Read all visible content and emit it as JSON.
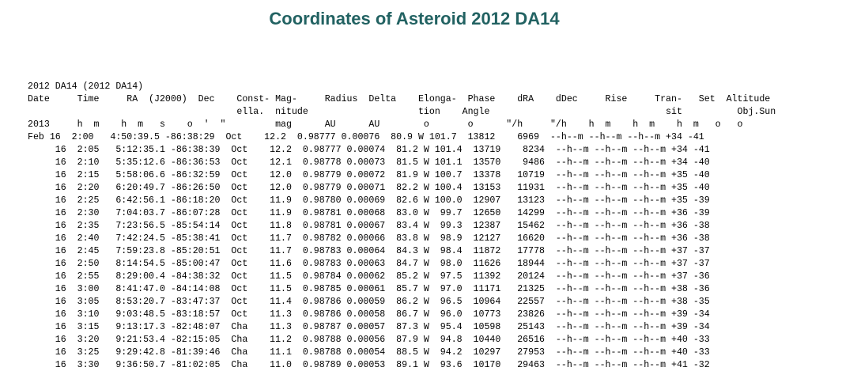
{
  "page": {
    "title": "Coordinates of Asteroid 2012 DA14"
  },
  "ephemeris": {
    "object_line": "2012 DA14 (2012 DA14)",
    "header_lines": [
      "Date     Time     RA  (J2000)  Dec    Const- Mag-     Radius  Delta    Elonga-  Phase    dRA    dDec     Rise     Tran-   Set  Altitude",
      "                                      ella.  nitude                    tion    Angle                                sit          Obj.Sun",
      "2013     h  m    h  m   s    o  '  \"         mag      AU      AU        o       o      \"/h     \"/h    h  m    h  m    h  m   o   o"
    ],
    "rows": [
      "Feb 16  2:00   4:50:39.5 -86:38:29  Oct    12.2  0.98777 0.00076  80.9 W 101.7  13812    6969  --h--m --h--m --h--m +34 -41",
      "     16  2:05   5:12:35.1 -86:38:39  Oct    12.2  0.98777 0.00074  81.2 W 101.4  13719    8234  --h--m --h--m --h--m +34 -41",
      "     16  2:10   5:35:12.6 -86:36:53  Oct    12.1  0.98778 0.00073  81.5 W 101.1  13570    9486  --h--m --h--m --h--m +34 -40",
      "     16  2:15   5:58:06.6 -86:32:59  Oct    12.0  0.98779 0.00072  81.9 W 100.7  13378   10719  --h--m --h--m --h--m +35 -40",
      "     16  2:20   6:20:49.7 -86:26:50  Oct    12.0  0.98779 0.00071  82.2 W 100.4  13153   11931  --h--m --h--m --h--m +35 -40",
      "     16  2:25   6:42:56.1 -86:18:20  Oct    11.9  0.98780 0.00069  82.6 W 100.0  12907   13123  --h--m --h--m --h--m +35 -39",
      "     16  2:30   7:04:03.7 -86:07:28  Oct    11.9  0.98781 0.00068  83.0 W  99.7  12650   14299  --h--m --h--m --h--m +36 -39",
      "     16  2:35   7:23:56.5 -85:54:14  Oct    11.8  0.98781 0.00067  83.4 W  99.3  12387   15462  --h--m --h--m --h--m +36 -38",
      "     16  2:40   7:42:24.5 -85:38:41  Oct    11.7  0.98782 0.00066  83.8 W  98.9  12127   16620  --h--m --h--m --h--m +36 -38",
      "     16  2:45   7:59:23.8 -85:20:51  Oct    11.7  0.98783 0.00064  84.3 W  98.4  11872   17778  --h--m --h--m --h--m +37 -37",
      "     16  2:50   8:14:54.5 -85:00:47  Oct    11.6  0.98783 0.00063  84.7 W  98.0  11626   18944  --h--m --h--m --h--m +37 -37",
      "     16  2:55   8:29:00.4 -84:38:32  Oct    11.5  0.98784 0.00062  85.2 W  97.5  11392   20124  --h--m --h--m --h--m +37 -36",
      "     16  3:00   8:41:47.0 -84:14:08  Oct    11.5  0.98785 0.00061  85.7 W  97.0  11171   21325  --h--m --h--m --h--m +38 -36",
      "     16  3:05   8:53:20.7 -83:47:37  Oct    11.4  0.98786 0.00059  86.2 W  96.5  10964   22557  --h--m --h--m --h--m +38 -35",
      "     16  3:10   9:03:48.5 -83:18:57  Oct    11.3  0.98786 0.00058  86.7 W  96.0  10773   23826  --h--m --h--m --h--m +39 -34",
      "     16  3:15   9:13:17.3 -82:48:07  Cha    11.3  0.98787 0.00057  87.3 W  95.4  10598   25143  --h--m --h--m --h--m +39 -34",
      "     16  3:20   9:21:53.4 -82:15:05  Cha    11.2  0.98788 0.00056  87.9 W  94.8  10440   26516  --h--m --h--m --h--m +40 -33",
      "     16  3:25   9:29:42.8 -81:39:46  Cha    11.1  0.98788 0.00054  88.5 W  94.2  10297   27953  --h--m --h--m --h--m +40 -33",
      "     16  3:30   9:36:50.7 -81:02:05  Cha    11.0  0.98789 0.00053  89.1 W  93.6  10170   29463  --h--m --h--m --h--m +41 -32"
    ]
  }
}
